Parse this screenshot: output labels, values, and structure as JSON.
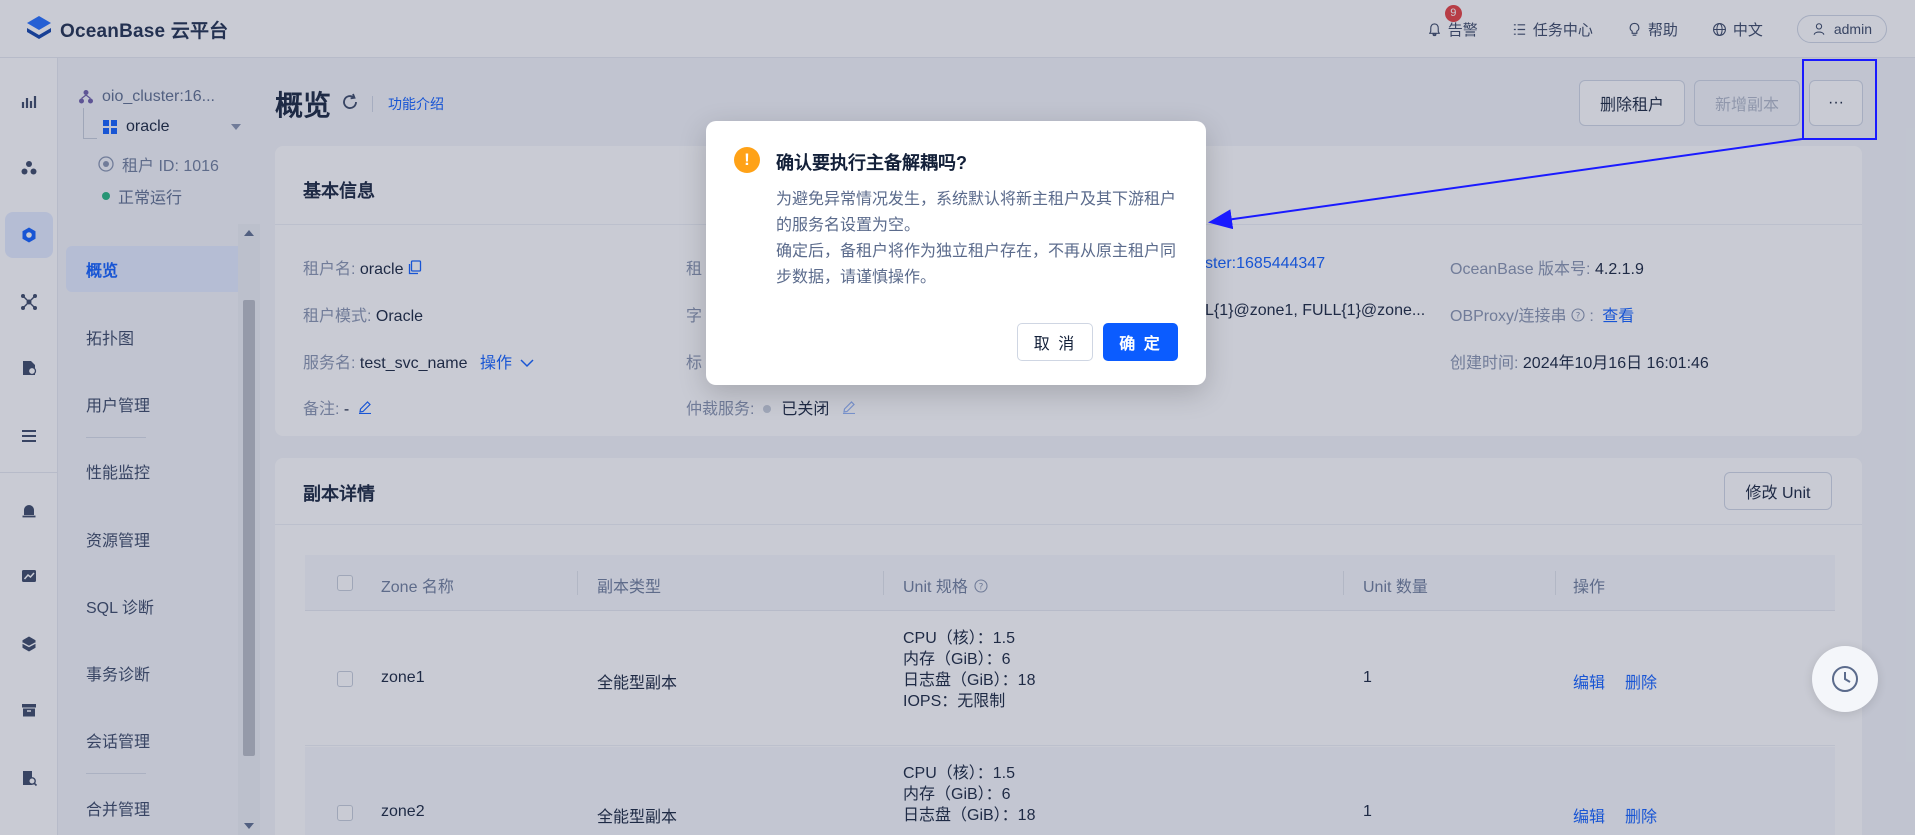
{
  "app": {
    "logo_text": "OceanBase 云平台"
  },
  "topbar": {
    "alerts_label": "告警",
    "alerts_count": "9",
    "tasks_label": "任务中心",
    "help_label": "帮助",
    "lang_label": "中文",
    "user_label": "admin"
  },
  "sidebar": {
    "cluster": "oio_cluster:16...",
    "tenant": "oracle",
    "tenant_id": "租户 ID: 1016",
    "status": "正常运行",
    "items": [
      {
        "label": "概览",
        "active": true
      },
      {
        "label": "拓扑图"
      },
      {
        "label": "用户管理"
      },
      {
        "label": "性能监控"
      },
      {
        "label": "资源管理"
      },
      {
        "label": "SQL 诊断"
      },
      {
        "label": "事务诊断"
      },
      {
        "label": "会话管理"
      },
      {
        "label": "合并管理"
      }
    ]
  },
  "header": {
    "title": "概览",
    "feature_link": "功能介绍",
    "delete_tenant": "删除租户",
    "add_replica": "新增副本",
    "more": "···"
  },
  "basic_info": {
    "title": "基本信息",
    "tenant_name_label": "租户名:",
    "tenant_name": "oracle",
    "tenant_mode_label": "租户模式:",
    "tenant_mode": "Oracle",
    "service_name_label": "服务名:",
    "service_name": "test_svc_name",
    "service_action": "操作",
    "remark_label": "备注:",
    "remark": "-",
    "col2_label_1": "租",
    "col2_label_2": "字",
    "col2_label_3": "标",
    "arbitration_label": "仲裁服务:",
    "arbitration_value": "已关闭",
    "cluster_link": "ster:1685444347",
    "locality": "L{1}@zone1, FULL{1}@zone...",
    "ob_version_label": "OceanBase 版本号:",
    "ob_version": "4.2.1.9",
    "obproxy_label": "OBProxy/连接串",
    "obproxy_link": "查看",
    "created_label": "创建时间:",
    "created_value": "2024年10月16日 16:01:46"
  },
  "replicas": {
    "title": "副本详情",
    "modify_unit": "修改 Unit",
    "columns": [
      "Zone 名称",
      "副本类型",
      "Unit 规格",
      "Unit 数量",
      "操作"
    ],
    "rows": [
      {
        "zone": "zone1",
        "type": "全能型副本",
        "cpu": "CPU（核）：1.5",
        "mem": "内存（GiB）：6",
        "log": "日志盘（GiB）：18",
        "iops": "IOPS：无限制",
        "count": "1",
        "edit": "编辑",
        "delete": "删除"
      },
      {
        "zone": "zone2",
        "type": "全能型副本",
        "cpu": "CPU（核）：1.5",
        "mem": "内存（GiB）：6",
        "log": "日志盘（GiB）：18",
        "count": "1",
        "edit": "编辑",
        "delete": "删除"
      }
    ]
  },
  "modal": {
    "title": "确认要执行主备解耦吗?",
    "body_1": "为避免异常情况发生，系统默认将新主租户及其下游租户的服务名设置为空。",
    "body_2": "确定后，备租户将作为独立租户存在，不再从原主租户同步数据，请谨慎操作。",
    "cancel": "取 消",
    "ok": "确 定"
  },
  "colors": {
    "accent": "#0b5cff",
    "warning": "#ffa217",
    "annotation": "#1a1aff"
  }
}
